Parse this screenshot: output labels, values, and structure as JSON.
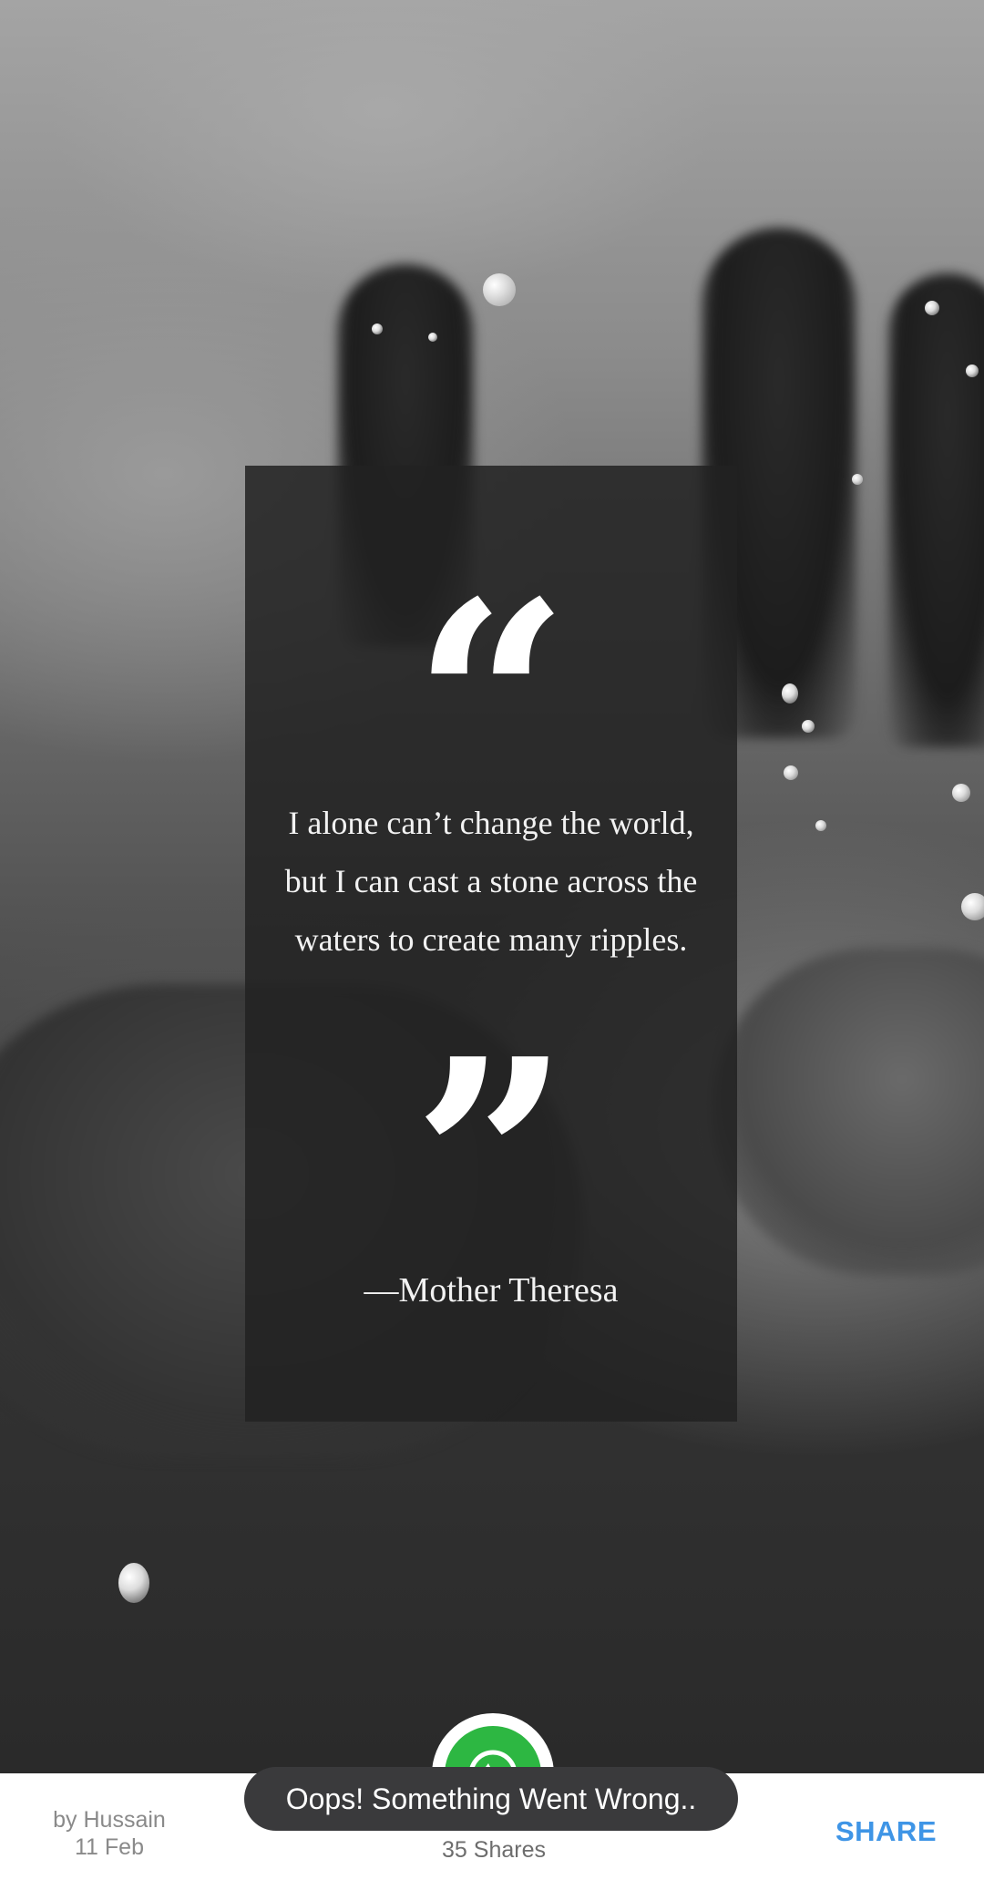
{
  "quote": {
    "open_mark": "“",
    "text": "I alone can’t change the world, but I can cast a stone across the waters to create many ripples.",
    "close_mark": "”",
    "author": "—Mother Theresa"
  },
  "fab": {
    "icon": "whatsapp-icon",
    "color": "#2db742"
  },
  "footer": {
    "author_line": "by Hussain",
    "date": "11 Feb",
    "shares": "35 Shares",
    "share_label": "SHARE",
    "accent": "#3f95e6"
  },
  "toast": {
    "message": "Oops! Something Went Wrong.."
  }
}
